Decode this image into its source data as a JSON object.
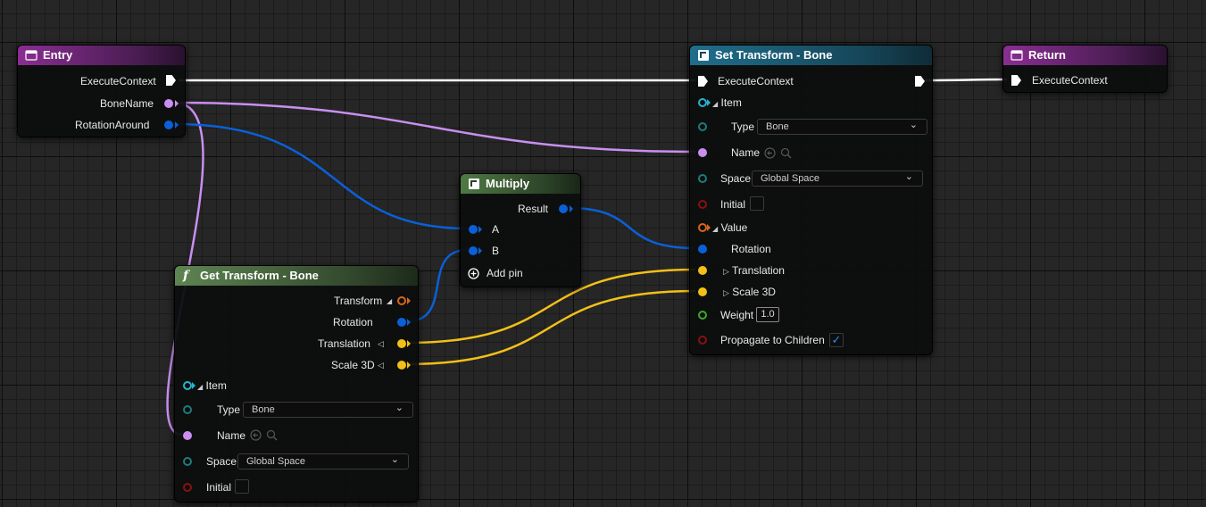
{
  "nodes": {
    "entry": {
      "title": "Entry",
      "pins": {
        "exec": "ExecuteContext",
        "bone_name": "BoneName",
        "rotation_around": "RotationAround"
      }
    },
    "set_transform": {
      "title": "Set Transform - Bone",
      "pins": {
        "exec": "ExecuteContext",
        "item": "Item",
        "type_label": "Type",
        "type_value": "Bone",
        "name": "Name",
        "space_label": "Space",
        "space_value": "Global Space",
        "initial": "Initial",
        "value": "Value",
        "rotation": "Rotation",
        "translation": "Translation",
        "scale": "Scale 3D",
        "weight_label": "Weight",
        "weight_value": "1.0",
        "propagate": "Propagate to Children",
        "propagate_checked": "✓"
      }
    },
    "return": {
      "title": "Return",
      "pins": {
        "exec": "ExecuteContext"
      }
    },
    "multiply": {
      "title": "Multiply",
      "pins": {
        "result": "Result",
        "a": "A",
        "b": "B",
        "add_pin": "Add pin"
      }
    },
    "get_transform": {
      "title": "Get Transform - Bone",
      "func_glyph": "f",
      "pins": {
        "transform": "Transform",
        "rotation": "Rotation",
        "translation": "Translation",
        "scale": "Scale 3D",
        "item": "Item",
        "type_label": "Type",
        "type_value": "Bone",
        "name": "Name",
        "space_label": "Space",
        "space_value": "Global Space",
        "initial": "Initial"
      }
    }
  },
  "chevron": "⌄",
  "colors": {
    "exec_wire": "#ffffff",
    "name_wire": "#c98ff0",
    "rotation_wire": "#0a60d8",
    "vector_wire": "#f2c018",
    "entry_header": "#8a2e92",
    "set_header": "#1f6e8c",
    "multiply_header": "#4f7a44",
    "get_header": "#5e8452"
  },
  "icons": {
    "node_icon": "node-graph-icon",
    "function_icon": "function-icon",
    "reset_icon": "reset-arrow-icon",
    "search_icon": "search-icon",
    "add_icon": "add-circle-icon"
  }
}
